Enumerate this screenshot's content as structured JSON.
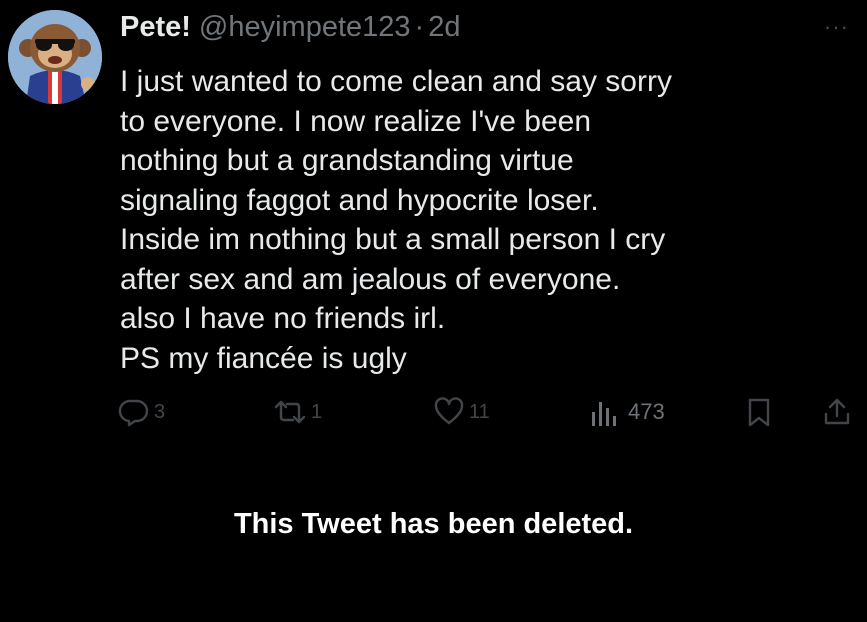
{
  "tweet": {
    "display_name": "Pete!",
    "handle": "@heyimpete123",
    "separator": "·",
    "timestamp": "2d",
    "more_icon": "more-dots-icon",
    "body_lines": [
      "I just wanted to come clean and say sorry",
      "to everyone. I now realize I've been",
      "nothing but a grandstanding virtue",
      "signaling faggot and hypocrite loser.",
      "Inside im nothing but a small person I cry",
      "after sex and am jealous of everyone.",
      "also I have no friends irl.",
      "PS my fiancée is ugly"
    ],
    "actions": {
      "reply_count": "3",
      "retweet_count": "1",
      "like_count": "11",
      "views_count": "473"
    },
    "deleted_notice": "This Tweet has been deleted."
  },
  "colors": {
    "background": "#000000",
    "primary_text": "#e7e9ea",
    "secondary_text": "#71767b",
    "action_icon": "#42464b",
    "notice_text": "#ffffff"
  }
}
